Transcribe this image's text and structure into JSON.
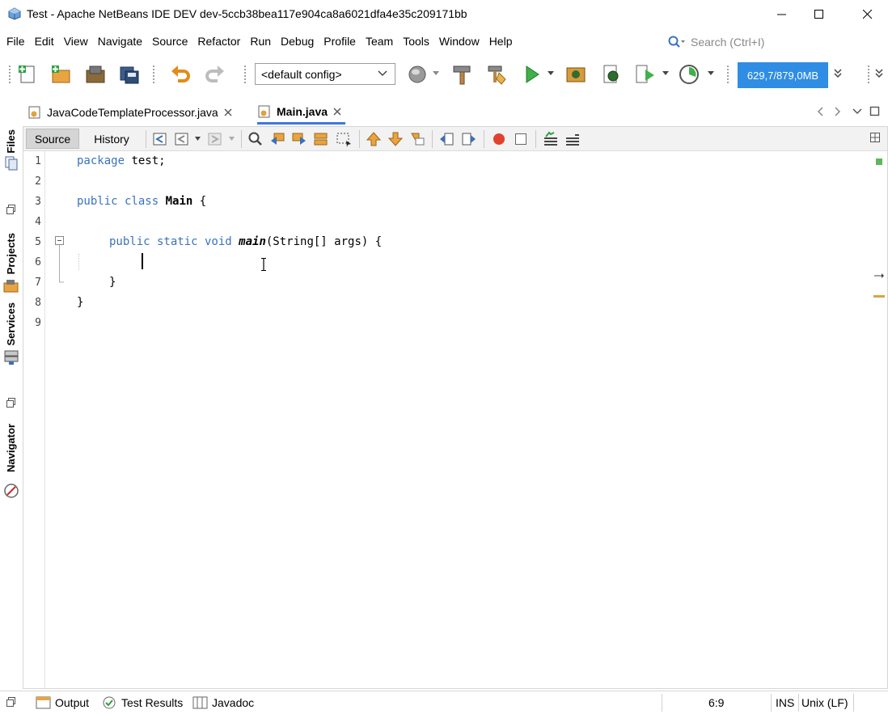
{
  "window": {
    "title": "Test - Apache NetBeans IDE DEV dev-5ccb38bea117e904ca8a6021dfa4e35c209171bb",
    "icon": "netbeans-cube-icon"
  },
  "menu": {
    "items": [
      "File",
      "Edit",
      "View",
      "Navigate",
      "Source",
      "Refactor",
      "Run",
      "Debug",
      "Profile",
      "Team",
      "Tools",
      "Window",
      "Help"
    ]
  },
  "search": {
    "placeholder": "Search (Ctrl+I)"
  },
  "toolbar": {
    "config": "<default config>",
    "memory": "629,7/879,0MB"
  },
  "tabs": [
    {
      "label": "JavaCodeTemplateProcessor.java",
      "active": false
    },
    {
      "label": "Main.java",
      "active": true
    }
  ],
  "side_panels": [
    "Files",
    "Projects",
    "Services",
    "Navigator"
  ],
  "editor": {
    "source_label": "Source",
    "history_label": "History",
    "line_numbers": [
      "1",
      "2",
      "3",
      "4",
      "5",
      "6",
      "7",
      "8",
      "9"
    ],
    "code": {
      "l1_kw": "package",
      "l1_rest": " test;",
      "l3_kw": "public class",
      "l3_name": "Main",
      "l3_rest": " {",
      "l5_kw": "public static void",
      "l5_name": "main",
      "l5_rest": "(String[] args) {",
      "l7": "}",
      "l8": "}"
    }
  },
  "bottom": {
    "output": "Output",
    "test_results": "Test Results",
    "javadoc": "Javadoc",
    "position": "6:9",
    "mode": "INS",
    "line_ending": "Unix (LF)"
  },
  "colors": {
    "keyword": "#3a72c0",
    "accent": "#2f8de4",
    "active_tab_underline": "#3d7ad8"
  }
}
